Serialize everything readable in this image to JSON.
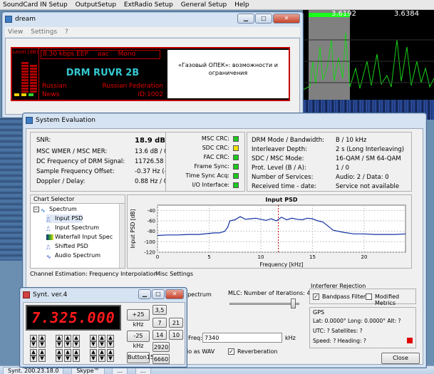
{
  "background": {
    "menubar": [
      "SoundCard IN Setup",
      "OutputSetup",
      "ExtRadio Setup",
      "General Setup",
      "Help"
    ],
    "spectrum_freqs": [
      "3.6192",
      "3.6384"
    ],
    "taskbar_items": [
      "Synt. 200.23.18.0",
      "Skype™",
      "...",
      "..."
    ]
  },
  "dream": {
    "title": "dream",
    "menu": [
      "View",
      "Settings",
      "?"
    ],
    "level_label": "Level [dB]",
    "bitrate": "8.30 kbps EEP",
    "codec": "aac",
    "audio_mode": "Mono",
    "station": "DRM RUVR 2B",
    "language": "Russian",
    "country": "Russian Federation",
    "genre": "News",
    "service_id": "ID:1002",
    "text_message": "«Газовый ОПЕК»: возможности и ограничения"
  },
  "syseval": {
    "title": "System Evaluation",
    "left": [
      {
        "label": "SNR:",
        "value": "18.9 dB",
        "bold": true
      },
      {
        "label": "MSC WMER / MSC MER:",
        "value": "13.6 dB / 0.0 dB"
      },
      {
        "label": "DC Frequency of DRM Signal:",
        "value": "11726.58 Hz"
      },
      {
        "label": "Sample Frequency Offset:",
        "value": "-0.37 Hz (-7 ppm)"
      },
      {
        "label": "Doppler / Delay:",
        "value": "0.88 Hz / 0.92 ms"
      }
    ],
    "crc": [
      {
        "label": "MSC CRC:",
        "color": "#1ec81e"
      },
      {
        "label": "SDC CRC:",
        "color": "#f0e000"
      },
      {
        "label": "FAC CRC:",
        "color": "#1ec81e"
      },
      {
        "label": "Frame Sync:",
        "color": "#1ec81e"
      },
      {
        "label": "Time Sync Acq:",
        "color": "#1ec81e"
      },
      {
        "label": "I/O Interface:",
        "color": "#1ec81e"
      }
    ],
    "right": [
      {
        "label": "DRM Mode / Bandwidth:",
        "value": "B / 10 kHz"
      },
      {
        "label": "Interleaver Depth:",
        "value": "2 s (Long Interleaving)"
      },
      {
        "label": "SDC / MSC Mode:",
        "value": "16-QAM / SM 64-QAM"
      },
      {
        "label": "Prot. Level (B / A):",
        "value": "1 / 0"
      },
      {
        "label": "Number of Services:",
        "value": "Audio: 2 / Data: 0"
      },
      {
        "label": "Received time - date:",
        "value": "Service not available"
      }
    ],
    "chart_selector": {
      "title": "Chart Selector",
      "items": [
        "Spectrum",
        "Input PSD",
        "Input Spectrum",
        "Waterfall Input Spec",
        "Shifted PSD",
        "Audio Spectrum"
      ]
    },
    "bottom": {
      "channel_estimation": "Channel Estimation: Frequency Interpolation",
      "misc_settings": "Misc Settings",
      "spectrum_partial": "Spectrum",
      "mlc_label": "MLC: Number of Iterations: 4",
      "freq_label": "Freq:",
      "freq_value": "7340",
      "freq_unit": "kHz",
      "save_partial": "io as WAV",
      "reverberation": "Reverberation",
      "interferer_title": "Interferer Rejection",
      "bandpass": "Bandpass Filter",
      "modified_metrics": "Modified Metrics",
      "gps_title": "GPS",
      "gps_latlong": "Lat: 0.0000°  Long: 0.0000°  Alt: ?",
      "gps_utc": "UTC: ?  Satellites: ?",
      "gps_speed": "Speed: ?  Heading: ?",
      "close": "Close"
    }
  },
  "chart_data": {
    "type": "line",
    "title": "Input PSD",
    "xlabel": "Frequency [kHz]",
    "ylabel": "Input PSD [dB]",
    "xlim": [
      0,
      24
    ],
    "ylim": [
      -120,
      -30
    ],
    "xticks": [
      "0",
      "5",
      "10",
      "15",
      "20"
    ],
    "yticks": [
      "-40",
      "-60",
      "-80",
      "-100",
      "-120"
    ],
    "marker_x": 11.7,
    "series": [
      {
        "x": [
          0,
          1,
          2,
          3,
          4,
          5,
          5.5,
          6,
          6.5,
          6.8,
          7,
          7.5,
          8,
          8.5,
          9,
          9.5,
          10,
          10.5,
          11,
          11.5,
          12,
          12.5,
          13,
          13.5,
          14,
          14.5,
          15,
          15.5,
          16,
          16.5,
          17,
          18,
          19,
          20,
          21,
          22,
          23,
          24
        ],
        "values": [
          -88,
          -87,
          -87,
          -86,
          -86,
          -84,
          -83,
          -83,
          -80,
          -72,
          -60,
          -58,
          -52,
          -57,
          -56,
          -55,
          -57,
          -59,
          -56,
          -60,
          -53,
          -58,
          -55,
          -57,
          -58,
          -55,
          -56,
          -60,
          -62,
          -70,
          -78,
          -82,
          -85,
          -85,
          -86,
          -86,
          -86,
          -85
        ]
      }
    ]
  },
  "synt": {
    "title": "Synt. ver.4",
    "frequency": "7.325.000",
    "step_buttons": [
      "+25 kHz",
      "-25 kHz",
      "Button15"
    ],
    "band_buttons": [
      "3,5",
      "7",
      "21",
      "14",
      "10",
      "2920",
      "6660"
    ]
  }
}
